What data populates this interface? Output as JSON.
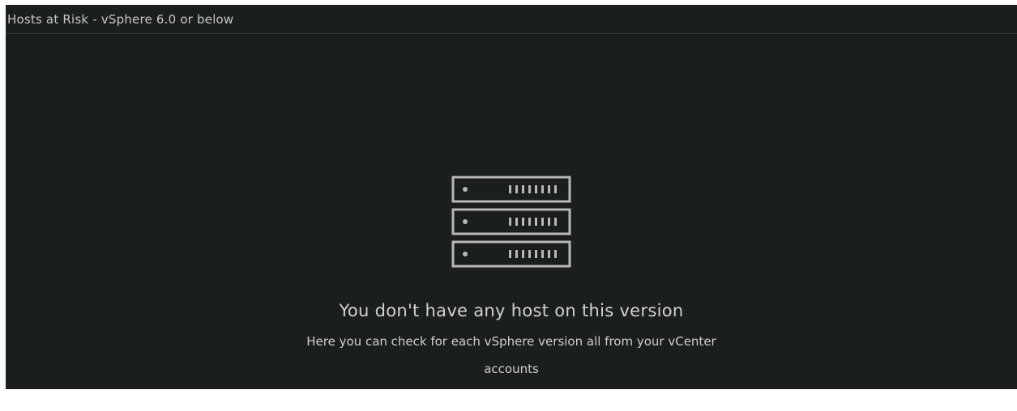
{
  "panel": {
    "title": "Hosts at Risk - vSphere 6.0 or below"
  },
  "empty_state": {
    "icon": "server-rack-icon",
    "heading": "You don't have any host on this version",
    "description": "Here you can check for each vSphere version all from your vCenter accounts"
  },
  "colors": {
    "background": "#1b1e1f",
    "text": "#d2d2ce",
    "icon": "#b8b8b4"
  }
}
